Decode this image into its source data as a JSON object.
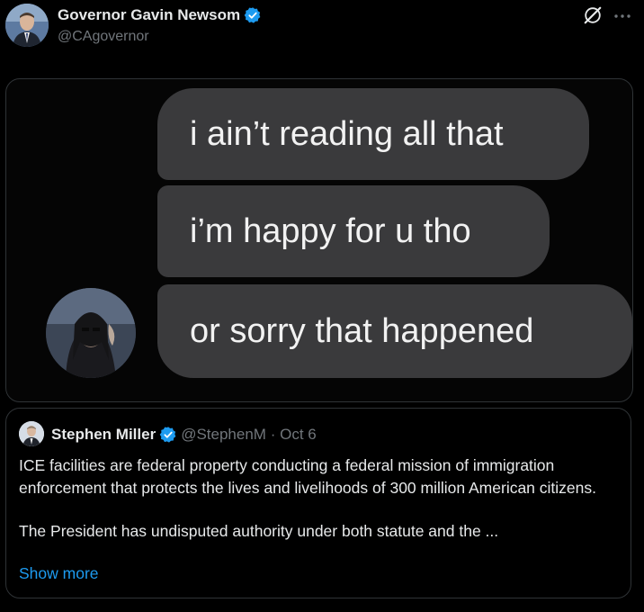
{
  "post": {
    "author_name": "Governor Gavin Newsom",
    "author_handle": "@CAgovernor",
    "verified_color": "#1d9bf0",
    "icons": [
      "grok-icon",
      "more-icon"
    ]
  },
  "media": {
    "messages": [
      "i ain’t reading all that",
      "i’m happy for u tho",
      "or sorry that happened"
    ],
    "bubble_color": "#3a3a3c"
  },
  "quote": {
    "author_name": "Stephen Miller",
    "author_handle": "@StephenM",
    "separator": "·",
    "date": "Oct 6",
    "paragraphs": [
      "ICE facilities are federal property conducting a federal mission of immigration enforcement that protects the lives and livelihoods of 300 million American citizens.",
      "The President has undisputed authority under both statute and the ..."
    ],
    "show_more": "Show more",
    "link_color": "#1d9bf0"
  }
}
